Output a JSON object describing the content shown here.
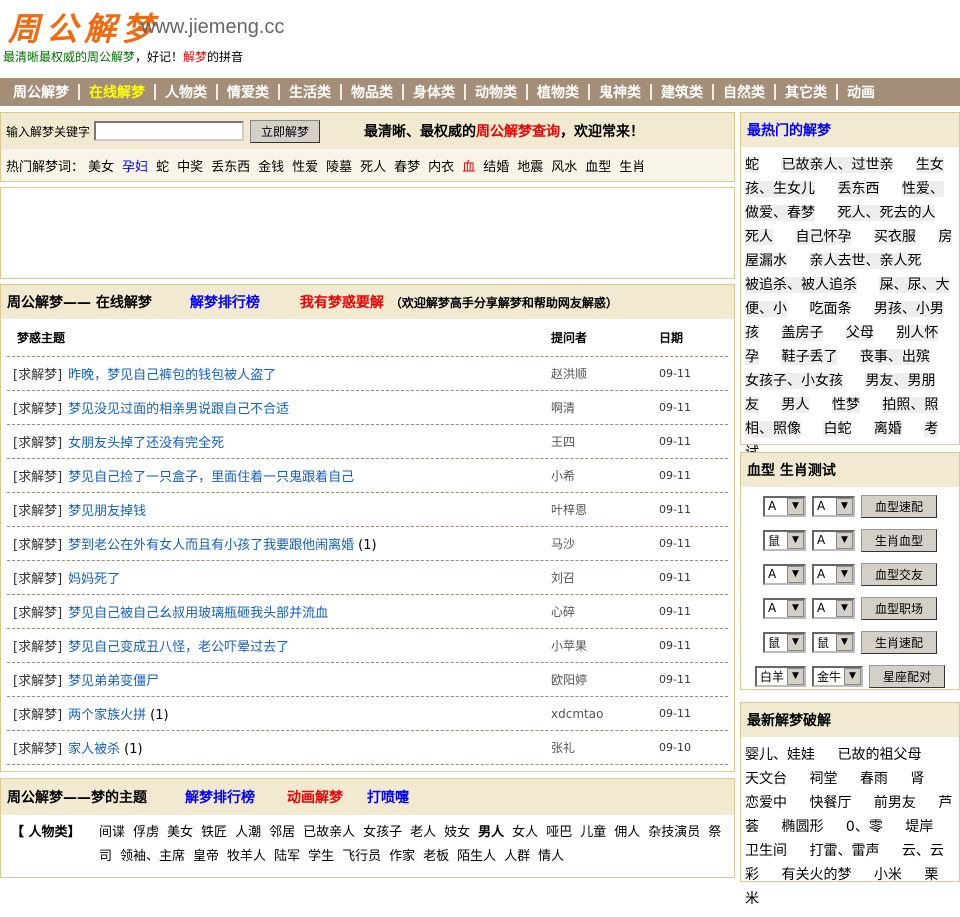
{
  "header": {
    "logo": "周公解梦",
    "domain": "www.jiemeng.cc",
    "slogan_green": "最清晰最权威的周公解梦",
    "slogan_mid": "，好记！",
    "slogan_red": "解梦",
    "slogan_end": "的拼音"
  },
  "nav": [
    {
      "label": "周公解梦"
    },
    {
      "label": "在线解梦",
      "active": true
    },
    {
      "label": "人物类"
    },
    {
      "label": "情爱类"
    },
    {
      "label": "生活类"
    },
    {
      "label": "物品类"
    },
    {
      "label": "身体类"
    },
    {
      "label": "动物类"
    },
    {
      "label": "植物类"
    },
    {
      "label": "鬼神类"
    },
    {
      "label": "建筑类"
    },
    {
      "label": "自然类"
    },
    {
      "label": "其它类"
    },
    {
      "label": "动画"
    }
  ],
  "search": {
    "label": "输入解梦关键字",
    "value": "",
    "button": "立即解梦",
    "welcome_a": "最清晰、最权威的",
    "welcome_red": "周公解梦查询",
    "welcome_b": "，欢迎常来！",
    "hot_label": "热门解梦词：",
    "hot_words": [
      {
        "t": "美女"
      },
      {
        "t": "孕妇",
        "c": "blue"
      },
      {
        "t": "蛇"
      },
      {
        "t": "中奖"
      },
      {
        "t": "丢东西"
      },
      {
        "t": "金钱"
      },
      {
        "t": "性爱"
      },
      {
        "t": "陵墓"
      },
      {
        "t": "死人"
      },
      {
        "t": "春梦"
      },
      {
        "t": "内衣"
      },
      {
        "t": "血",
        "c": "red"
      },
      {
        "t": "结婚"
      },
      {
        "t": "地震"
      },
      {
        "t": "风水"
      },
      {
        "t": "血型"
      },
      {
        "t": "生肖"
      }
    ]
  },
  "online": {
    "title": "周公解梦—— 在线解梦",
    "rank": "解梦排行榜",
    "ask": "我有梦惑要解",
    "note": "（欢迎解梦高手分享解梦和帮助网友解惑）",
    "cols": [
      "梦惑主题",
      "提问者",
      "日期"
    ],
    "tag": "[求解梦]",
    "rows": [
      {
        "t": "昨晚，梦见自己裤包的钱包被人盗了",
        "n": "",
        "u": "赵洪顺",
        "d": "09-11"
      },
      {
        "t": "梦见没见过面的相亲男说跟自己不合适",
        "n": "",
        "u": "啊清",
        "d": "09-11"
      },
      {
        "t": "女朋友头掉了还没有完全死",
        "n": "",
        "u": "王四",
        "d": "09-11"
      },
      {
        "t": "梦见自己捡了一只盒子，里面住着一只鬼跟着自己",
        "n": "",
        "u": "小希",
        "d": "09-11"
      },
      {
        "t": "梦见朋友掉钱",
        "n": "",
        "u": "叶梓恩",
        "d": "09-11"
      },
      {
        "t": "梦到老公在外有女人而且有小孩了我要跟他闹离婚",
        "n": "(1)",
        "u": "马沙",
        "d": "09-11"
      },
      {
        "t": "妈妈死了",
        "n": "",
        "u": "刘召",
        "d": "09-11"
      },
      {
        "t": "梦见自己被自己幺叔用玻璃瓶砸我头部并流血",
        "n": "",
        "u": "心碎",
        "d": "09-11"
      },
      {
        "t": "梦见自己变成丑八怪，老公吓晕过去了",
        "n": "",
        "u": "小苹果",
        "d": "09-11"
      },
      {
        "t": "梦见弟弟变僵尸",
        "n": "",
        "u": "欧阳婷",
        "d": "09-11"
      },
      {
        "t": "两个家族火拼",
        "n": "(1)",
        "u": "xdcmtao",
        "d": "09-11"
      },
      {
        "t": "家人被杀",
        "n": "(1)",
        "u": "张礼",
        "d": "09-10"
      }
    ]
  },
  "themes": {
    "title": "周公解梦——梦的主题",
    "rank": "解梦排行榜",
    "anim": "动画解梦",
    "sneeze": "打喷嚏",
    "cat_label": "【 人物类】",
    "words": [
      "间谍",
      "俘虏",
      "美女",
      "铁匠",
      "人潮",
      "邻居",
      "已故亲人",
      "女孩子",
      "老人",
      "妓女",
      "男人",
      "女人",
      "哑巴",
      "儿童",
      "佣人",
      "杂技演员",
      "祭司",
      "领袖、主席",
      "皇帝",
      "牧羊人",
      "陆军",
      "学生",
      "飞行员",
      "作家",
      "老板",
      "陌生人",
      "人群",
      "情人"
    ]
  },
  "hot": {
    "title": "最热门的解梦",
    "tags": [
      "蛇",
      "已故亲人、过世亲",
      "生女孩、生女儿",
      "丢东西",
      "性爱、做爱、春梦",
      "死人、死去的人",
      "死人",
      "自己怀孕",
      "买衣服",
      "房屋漏水",
      "亲人去世、亲人死",
      "被追杀、被人追杀",
      "屎、尿、大便、小",
      "吃面条",
      "男孩、小男孩",
      "盖房子",
      "父母",
      "别人怀孕",
      "鞋子丢了",
      "丧事、出殡",
      "女孩子、小女孩",
      "男友、男朋友",
      "男人",
      "性梦",
      "拍照、照相、照像",
      "白蛇",
      "离婚",
      "考试"
    ]
  },
  "blood": {
    "title": "血型 生肖测试",
    "rows": [
      {
        "a": "A",
        "b": "A",
        "btn": "血型速配"
      },
      {
        "a": "鼠",
        "b": "A",
        "btn": "生肖血型"
      },
      {
        "a": "A",
        "b": "A",
        "btn": "血型交友"
      },
      {
        "a": "A",
        "b": "A",
        "btn": "血型职场"
      },
      {
        "a": "鼠",
        "b": "鼠",
        "btn": "生肖速配"
      },
      {
        "a": "白羊",
        "b": "金牛",
        "btn": "星座配对"
      }
    ]
  },
  "newest": {
    "title": "最新解梦破解",
    "tags": [
      "婴儿、娃娃",
      "已故的祖父母",
      "天文台",
      "祠堂",
      "春雨",
      "肾",
      "恋爱中",
      "快餐厅",
      "前男友",
      "芦荟",
      "椭圆形",
      "0、零",
      "堤岸",
      "卫生间",
      "打雷、雷声",
      "云、云彩",
      "有关火的梦",
      "小米",
      "栗米"
    ]
  }
}
